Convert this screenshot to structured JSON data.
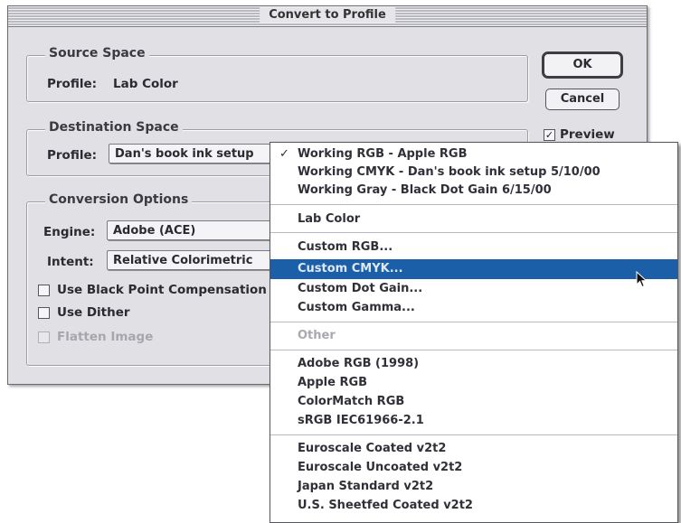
{
  "dialog": {
    "title": "Convert to Profile",
    "source_space": {
      "legend": "Source Space",
      "profile_label": "Profile:",
      "profile_value": "Lab Color"
    },
    "destination_space": {
      "legend": "Destination Space",
      "profile_label": "Profile:",
      "profile_value": "Dan's book ink setup"
    },
    "conversion_options": {
      "legend": "Conversion Options",
      "engine_label": "Engine:",
      "engine_value": "Adobe (ACE)",
      "intent_label": "Intent:",
      "intent_value": "Relative Colorimetric",
      "black_point_label": "Use Black Point Compensation",
      "dither_label": "Use Dither",
      "flatten_label": "Flatten Image"
    },
    "buttons": {
      "ok": "OK",
      "cancel": "Cancel"
    },
    "preview": {
      "label": "Preview",
      "checked": true
    }
  },
  "menu": {
    "checkmark": "✓",
    "items": [
      {
        "label": "Working RGB - Apple RGB",
        "checked": true
      },
      {
        "label": "Working CMYK - Dan's book ink setup 5/10/00"
      },
      {
        "label": "Working Gray - Black Dot Gain 6/15/00"
      },
      {
        "label": "Lab Color"
      },
      {
        "label": "Custom RGB..."
      },
      {
        "label": "Custom CMYK...",
        "selected": true
      },
      {
        "label": "Custom Dot Gain..."
      },
      {
        "label": "Custom Gamma..."
      },
      {
        "label": "Other",
        "disabled": true
      },
      {
        "label": "Adobe RGB (1998)"
      },
      {
        "label": "Apple RGB"
      },
      {
        "label": "ColorMatch RGB"
      },
      {
        "label": "sRGB IEC61966-2.1"
      },
      {
        "label": "Euroscale Coated v2t2"
      },
      {
        "label": "Euroscale Uncoated v2t2"
      },
      {
        "label": "Japan Standard v2t2"
      },
      {
        "label": "U.S. Sheetfed Coated v2t2"
      }
    ]
  },
  "colors": {
    "highlight": "#1a5fa8",
    "dialog_bg": "#e1e1e5"
  }
}
